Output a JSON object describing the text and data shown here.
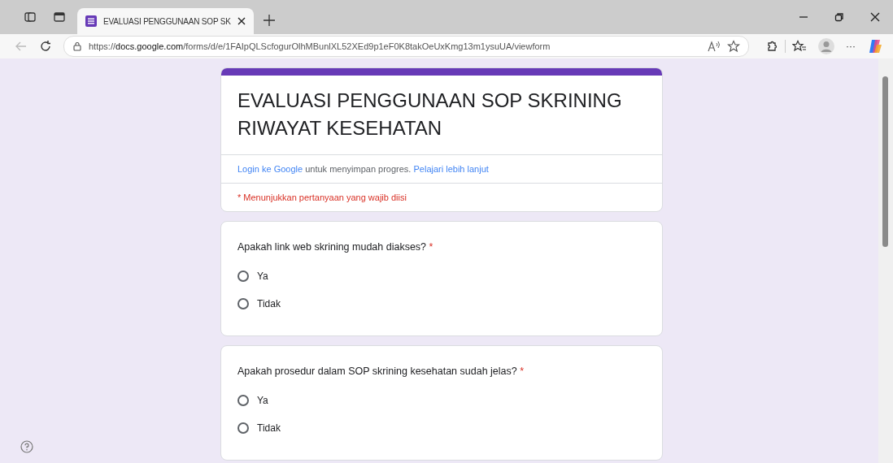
{
  "browser": {
    "tab": {
      "title": "EVALUASI PENGGUNAAN SOP SK",
      "selected": true
    },
    "url": "https://**docs.google.com**/forms/d/e/1FAIpQLScfogurOlhMBunlXL52XEd9p1eF0K8takOeUxKmg13m1ysuUA/viewform",
    "more_label": "···"
  },
  "form": {
    "title": "EVALUASI PENGGUNAAN SOP SKRINING RIWAYAT KESEHATAN",
    "login_link": "Login ke Google",
    "login_text": "untuk menyimpan progres.",
    "learn_link": "Pelajari lebih lanjut",
    "required_note": "* Menunjukkan pertanyaan yang wajib diisi",
    "questions": [
      {
        "text": "Apakah link web skrining mudah diakses?",
        "required_mark": "*",
        "options": [
          {
            "label": "Ya",
            "selected": false
          },
          {
            "label": "Tidak",
            "selected": false
          }
        ]
      },
      {
        "text": "Apakah prosedur dalam SOP skrining kesehatan sudah jelas?",
        "required_mark": "*",
        "options": [
          {
            "label": "Ya",
            "selected": false
          },
          {
            "label": "Tidak",
            "selected": false
          }
        ]
      }
    ]
  }
}
